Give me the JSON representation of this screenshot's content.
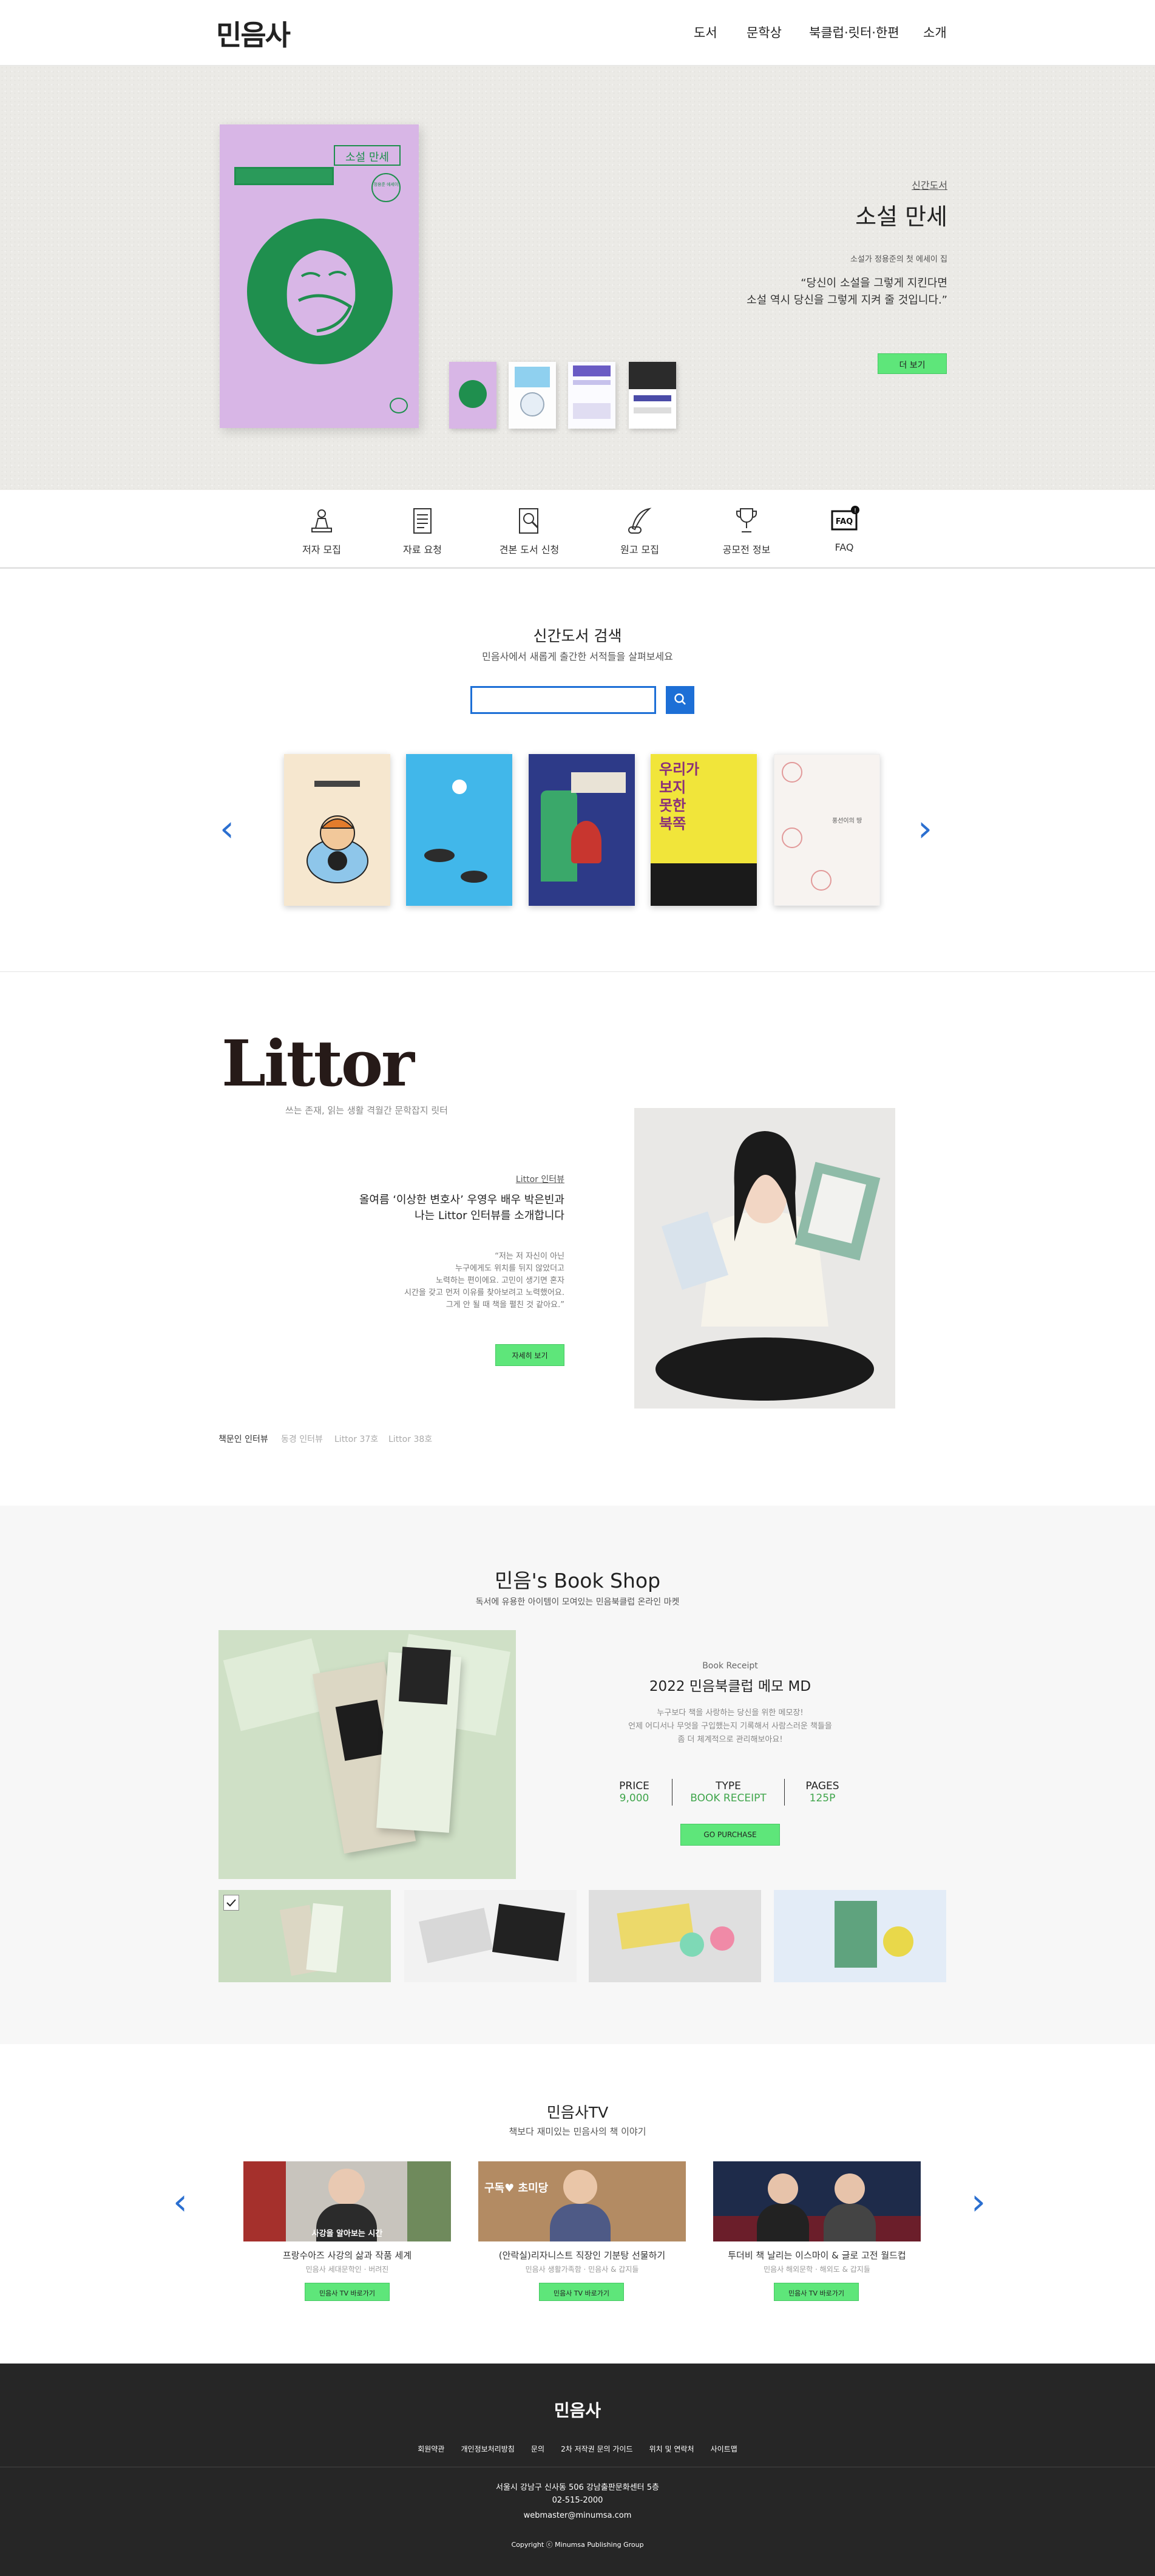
{
  "header": {
    "logo": "민음사",
    "nav": [
      "도서",
      "문학상",
      "북클럽·릿터·한편",
      "소개"
    ]
  },
  "hero": {
    "cover_title": "소설 만세",
    "cover_sub": "정용준 에세이",
    "label": "신간도서",
    "title": "소설 만세",
    "subtitle": "소설가 정용준의 첫 에세이 집",
    "quote_line1": "“당신이 소설을 그렇게 지킨다면",
    "quote_line2": "소설 역시 당신을 그렇게 지켜 줄 것입니다.”",
    "more_button": "더 보기"
  },
  "quick_menu": [
    {
      "label": "저자 모집",
      "icon": "author-icon"
    },
    {
      "label": "자료 요청",
      "icon": "document-request-icon"
    },
    {
      "label": "견본 도서 신청",
      "icon": "sample-book-icon"
    },
    {
      "label": "원고 모집",
      "icon": "quill-icon"
    },
    {
      "label": "공모전 정보",
      "icon": "trophy-icon"
    },
    {
      "label": "FAQ",
      "icon": "faq-icon"
    }
  ],
  "new_books": {
    "title": "신간도서 검색",
    "subtitle": "민음사에서 새롭게 출간한 서적들을 살펴보세요",
    "search_placeholder": "",
    "books": [
      {
        "name": "book-1",
        "color": "#f6e7cf"
      },
      {
        "name": "book-2",
        "color": "#41b7ea"
      },
      {
        "name": "book-3",
        "color": "#2d3a88"
      },
      {
        "name": "book-4",
        "color": "#f1e53a"
      },
      {
        "name": "book-5",
        "color": "#f7f3f0"
      }
    ],
    "book5_title": "풍선이의 땅"
  },
  "littor": {
    "logo": "Littor",
    "tagline": "쓰는 존재, 읽는 생활 격월간 문학잡지 릿터",
    "label": "Littor 인터뷰",
    "headline1": "올여름 ‘이상한 변호사’ 우영우 배우 박은빈과",
    "headline2": "나는 Littor 인터뷰를 소개합니다",
    "quote": [
      "“저는 저 자신이 아닌",
      "누구에게도 위치를 뒤지 않았더고",
      "노력하는 편이에요. 고민이 생기면 혼자",
      "시간을 갖고 먼저 이유를 찾아보려고 노력했어요.",
      "그게 안 될 때 책을 펼친 것 같아요.”"
    ],
    "button": "자세히 보기",
    "tabs": [
      "책문인 인터뷰",
      "동경 인터뷰",
      "Littor 37호",
      "Littor 38호"
    ]
  },
  "shop": {
    "title": "민음's Book Shop",
    "subtitle": "독서에 유용한 아이템이 모여있는 민음북클럽 온라인 마켓",
    "label": "Book Receipt",
    "product": "2022 민음북클럽 메모 MD",
    "desc": [
      "누구보다 책을 사랑하는 당신을 위한 메모장!",
      "언제 어디서나 무엇을 구입했는지 기록해서 사람스러운 책들을",
      "좀 더 체계적으로 관리해보아요!"
    ],
    "stats": [
      {
        "k": "PRICE",
        "v": "9,000"
      },
      {
        "k": "TYPE",
        "v": "BOOK RECEIPT"
      },
      {
        "k": "PAGES",
        "v": "125P"
      }
    ],
    "button": "GO PURCHASE"
  },
  "tv": {
    "title": "민음사TV",
    "subtitle": "책보다 재미있는 민음사의 책 이야기",
    "videos": [
      {
        "title": "프랑수아즈 사강의 삶과 작품 세계",
        "sub": "민음사 세대문학인 · 버려진",
        "thumb_text": "사강을 알아보는 시간"
      },
      {
        "title": "(안락실)리자니스트 직장인 기분탕 선물하기",
        "sub": "민음사 생활가족함 · 민음사 & 갑지들",
        "thumb_text": "구독♥  초미당"
      },
      {
        "title": "투더비 책 날리는 이스마이 & 글로 고전 월드컵",
        "sub": "민음사 해외문학 · 해외도 & 갑지들",
        "thumb_text": ""
      }
    ],
    "button": "민음사 TV 바로가기"
  },
  "footer": {
    "logo": "민음사",
    "links": [
      "회원약관",
      "개인정보처리방침",
      "문의",
      "2차 저작권 문의 가이드",
      "위치 및 연락처",
      "사이트맵"
    ],
    "address": "서울시 강남구 신사동 506 강남출판문화센터 5층",
    "phone": "02-515-2000",
    "email": "webmaster@minumsa.com",
    "copyright": "Copyright ⓒ Minumsa Publishing Group"
  }
}
